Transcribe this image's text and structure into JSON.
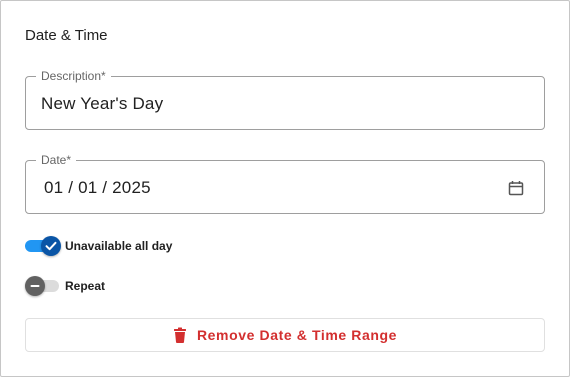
{
  "section": {
    "title": "Date & Time"
  },
  "description_field": {
    "label": "Description*",
    "value": "New Year's Day"
  },
  "date_field": {
    "label": "Date*",
    "value": "01 / 01 / 2025",
    "icon": "calendar-icon"
  },
  "toggles": [
    {
      "label": "Unavailable all day",
      "checked": true,
      "icon": "check-icon"
    },
    {
      "label": "Repeat",
      "checked": false,
      "icon": "minus-icon"
    }
  ],
  "remove_button": {
    "label": "Remove Date & Time Range",
    "icon": "trash-icon"
  },
  "colors": {
    "accent": "#2196f3",
    "accent_dark": "#0a55a6",
    "danger": "#d32f2f",
    "border": "#9e9e9e"
  }
}
